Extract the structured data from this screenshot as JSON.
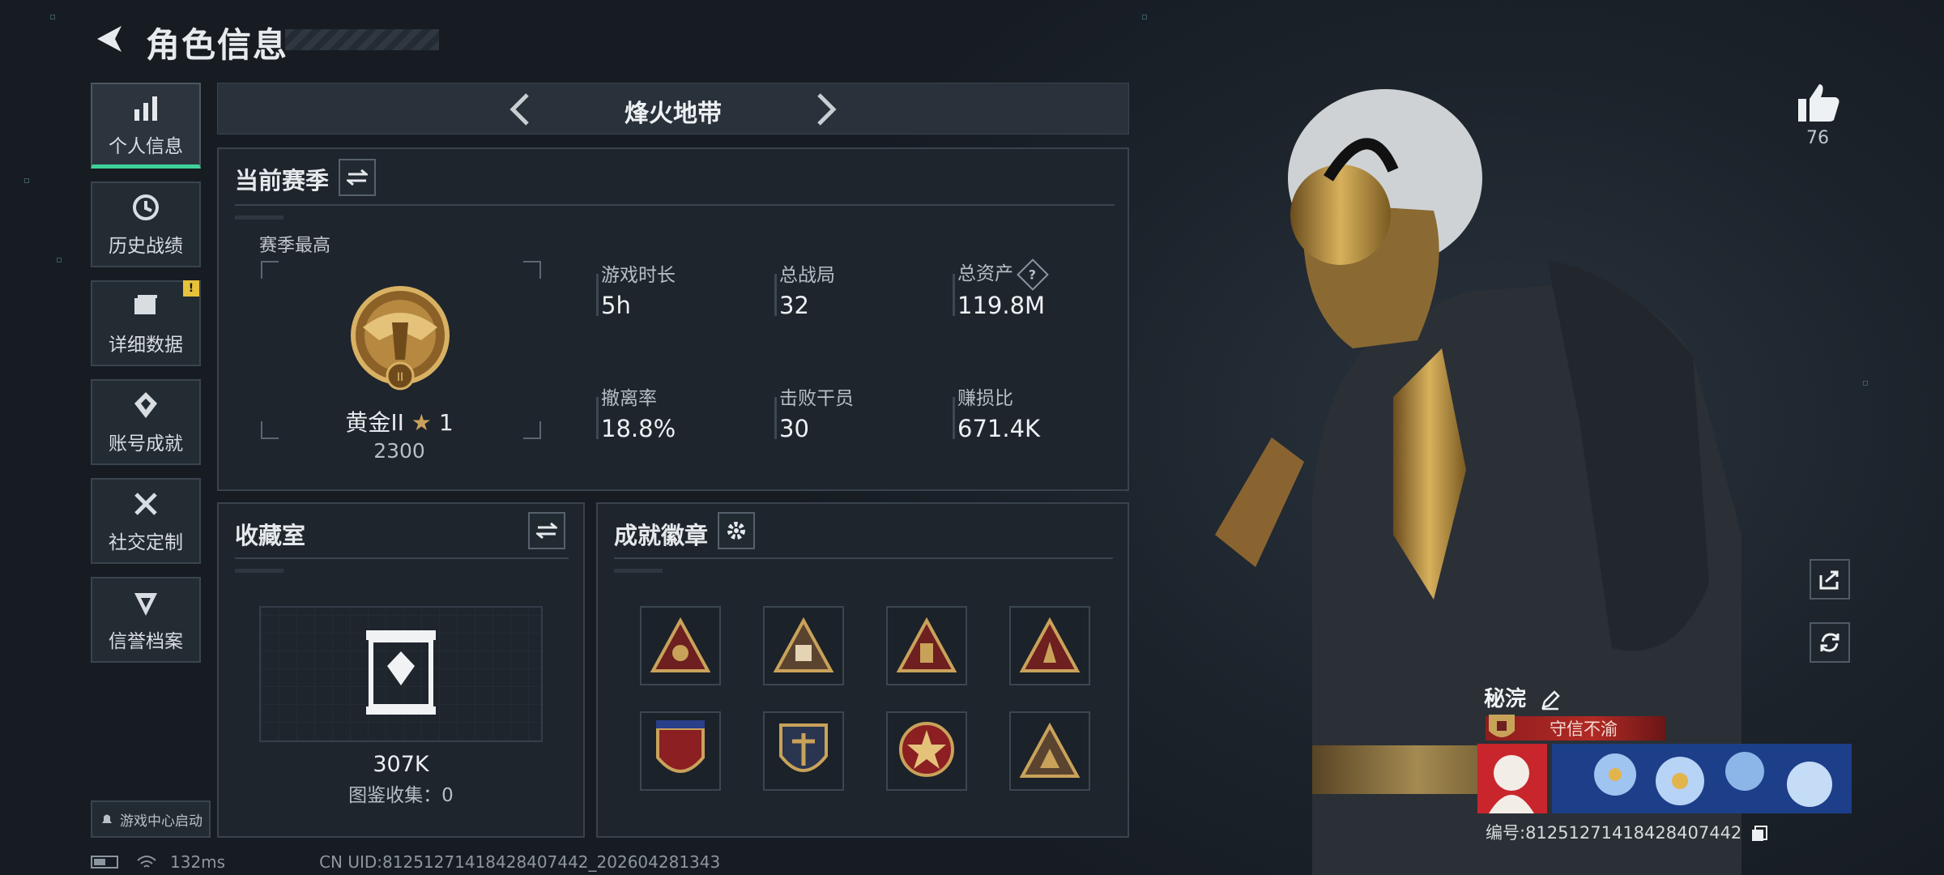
{
  "header": {
    "title": "角色信息"
  },
  "nav": [
    {
      "label": "个人信息",
      "icon": "bar-chart-icon",
      "active": true
    },
    {
      "label": "历史战绩",
      "icon": "history-icon"
    },
    {
      "label": "详细数据",
      "icon": "folder-icon",
      "badge": "!"
    },
    {
      "label": "账号成就",
      "icon": "achievement-icon"
    },
    {
      "label": "社交定制",
      "icon": "tools-icon"
    },
    {
      "label": "信誉档案",
      "icon": "shield-icon"
    }
  ],
  "launch": {
    "label": "游戏中心启动"
  },
  "status": {
    "ping": "132ms",
    "uid_line": "CN UID:8125127141842840​7442_202604281343"
  },
  "map": {
    "title": "烽火地带"
  },
  "season": {
    "title": "当前赛季",
    "best_label": "赛季最高",
    "rank_name": "黄金II",
    "rank_stars": "1",
    "rank_score": "2300",
    "stats": [
      {
        "label": "游戏时长",
        "value": "5h"
      },
      {
        "label": "总战局",
        "value": "32"
      },
      {
        "label": "总资产",
        "value": "119.8M",
        "help": "?"
      },
      {
        "label": "撤离率",
        "value": "18.8%"
      },
      {
        "label": "击败干员",
        "value": "30"
      },
      {
        "label": "赚损比",
        "value": "671.4K"
      }
    ]
  },
  "collection": {
    "title": "收藏室",
    "value": "307K",
    "count_line": "图鉴收集：0"
  },
  "badges": {
    "title": "成就徽章"
  },
  "player": {
    "likes": "76",
    "name": "秘浣",
    "motto": "守信不渝",
    "id_line": "编号:8125127141842840​7442"
  },
  "colors": {
    "accent": "#3fd39a",
    "gold": "#c9a25a",
    "motto_red": "#b22a24"
  }
}
